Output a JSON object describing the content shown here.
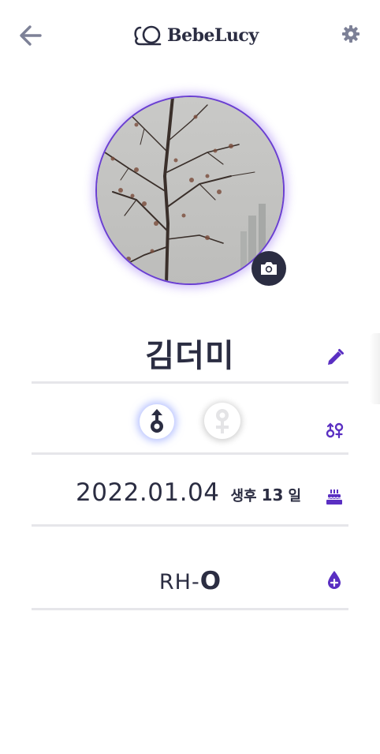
{
  "header": {
    "logo_text": "BebeLucy",
    "back_icon": "arrow-left-icon",
    "settings_icon": "gear-icon"
  },
  "profile": {
    "photo": "tree-photo",
    "camera_icon": "camera-icon",
    "name": "김더미",
    "edit_icon": "pencil-icon"
  },
  "gender": {
    "options": [
      "male",
      "female"
    ],
    "selected": "male",
    "row_icon": "gender-symbols-icon"
  },
  "birth": {
    "date": "2022.01.04",
    "age_label": "생후",
    "age_value": "13",
    "age_unit": "일",
    "icon": "cake-icon"
  },
  "blood": {
    "rh": "RH-",
    "type": "O",
    "icon": "blood-drop-icon"
  },
  "colors": {
    "accent": "#5a2fc2",
    "text": "#2b2d42",
    "divider": "#e6e6ea",
    "icon_gray": "#8a8fa8"
  }
}
